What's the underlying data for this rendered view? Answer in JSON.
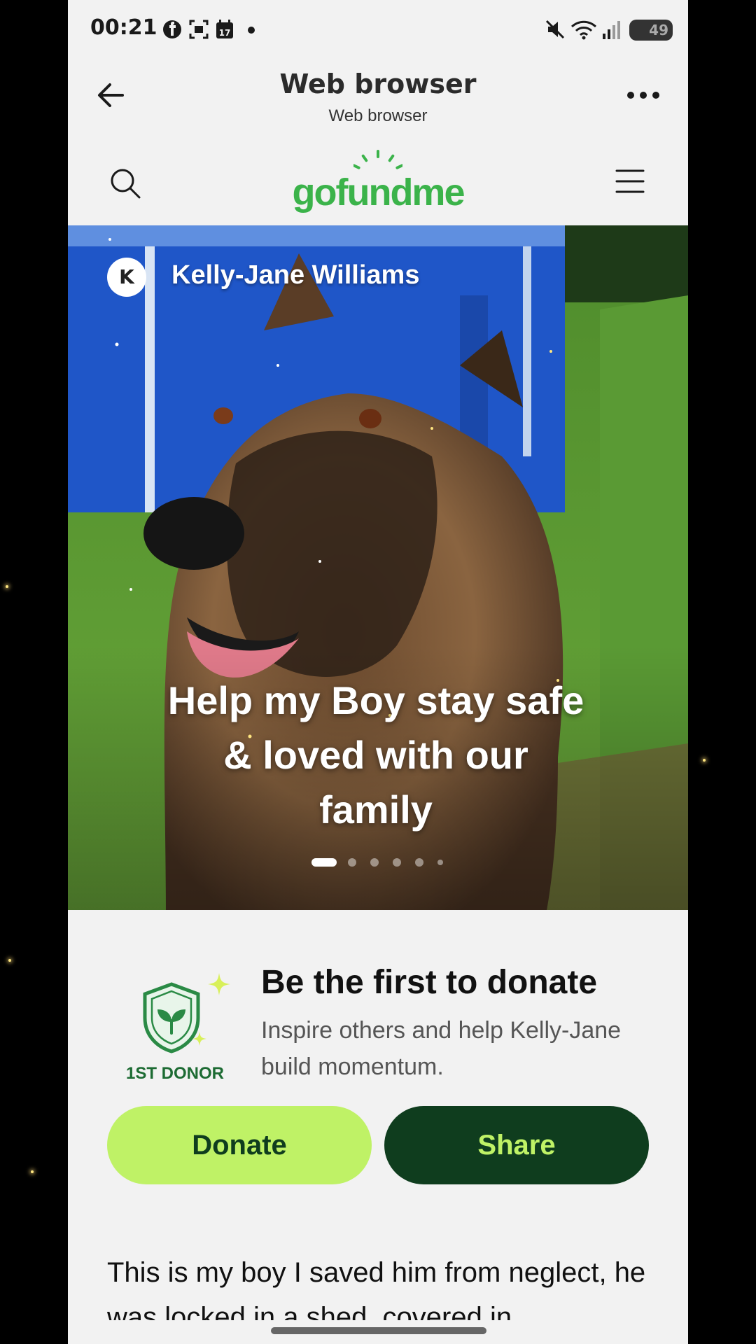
{
  "statusbar": {
    "time": "00:21",
    "battery": "49",
    "icons": [
      "facebook-icon",
      "screenshot-icon",
      "calendar-icon",
      "dot-icon",
      "mute-icon",
      "wifi-icon",
      "signal-icon",
      "battery-icon"
    ]
  },
  "appbar": {
    "title": "Web browser",
    "subtitle": "Web browser"
  },
  "site": {
    "logo": "gofundme",
    "logo_color": "#3bb34a"
  },
  "hero": {
    "organizer_initial": "K",
    "organizer_name": "Kelly-Jane Williams",
    "title": "Help my Boy stay safe & loved with our family",
    "slide_count": 6,
    "active_slide": 1
  },
  "cta": {
    "badge_label": "1ST DONOR",
    "heading": "Be the first to donate",
    "subtext": "Inspire others and help Kelly-Jane build momentum.",
    "donate_label": "Donate",
    "share_label": "Share"
  },
  "story": {
    "text": "This is my boy I saved him from neglect, he was locked in a shed, covered in"
  },
  "colors": {
    "accent_green": "#bff266",
    "dark_green": "#0f3d1e",
    "background": "#f2f2f2"
  }
}
